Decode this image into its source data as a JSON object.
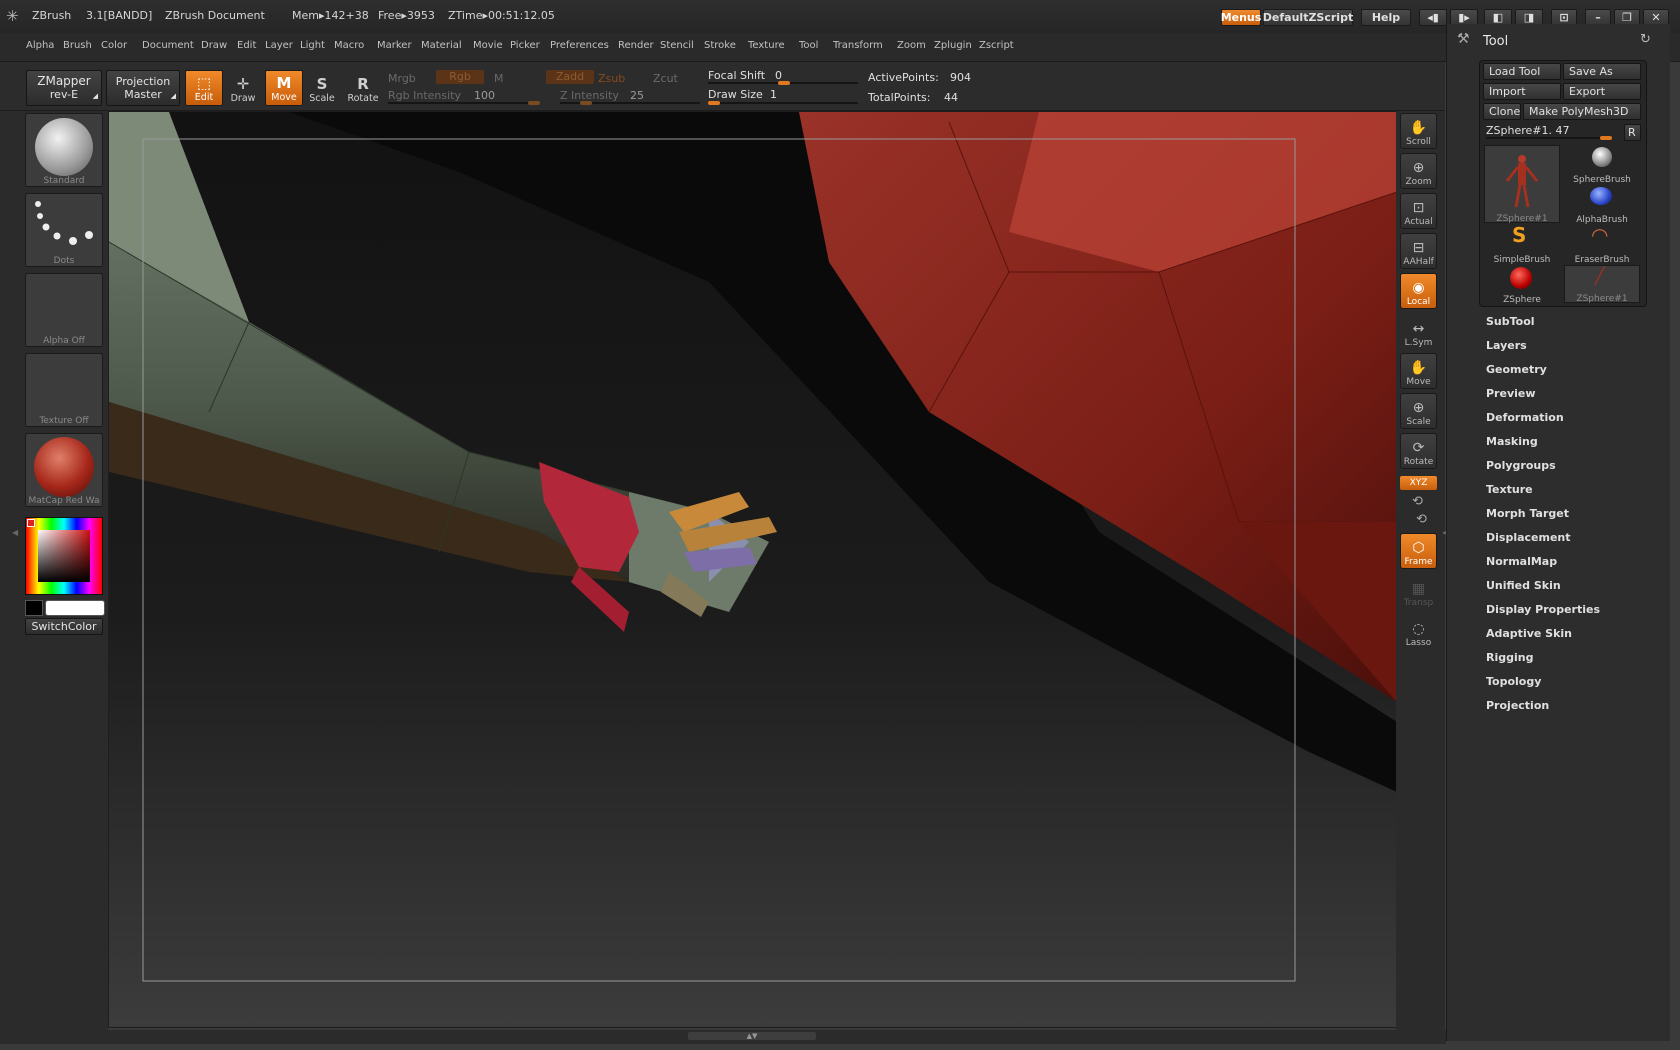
{
  "titlebar": {
    "app_name": "ZBrush",
    "version": "3.1[BANDD]",
    "document": "ZBrush Document",
    "mem": "Mem▸142+38",
    "free": "Free▸3953",
    "ztime": "ZTime▸00:51:12.05",
    "menus_label": "Menus",
    "zscript_label": "DefaultZScript",
    "help_label": "Help"
  },
  "menubar": {
    "items": [
      "Alpha",
      "Brush",
      "Color",
      "Document",
      "Draw",
      "Edit",
      "Layer",
      "Light",
      "Macro",
      "Marker",
      "Material",
      "Movie",
      "Picker",
      "Preferences",
      "Render",
      "Stencil",
      "Stroke",
      "Texture",
      "Tool",
      "Transform",
      "Zoom",
      "Zplugin",
      "Zscript"
    ]
  },
  "shelf": {
    "zmapper_line1": "ZMapper",
    "zmapper_line2": "rev-E",
    "projection_line1": "Projection",
    "projection_line2": "Master",
    "tools": [
      {
        "label": "Edit",
        "active": true
      },
      {
        "label": "Draw",
        "active": false
      },
      {
        "label": "Move",
        "active": true
      },
      {
        "label": "Scale",
        "active": false
      },
      {
        "label": "Rotate",
        "active": false
      }
    ],
    "mrgb": "Mrgb",
    "rgb_btn": "Rgb",
    "m": "M",
    "zadd": "Zadd",
    "zsub": "Zsub",
    "zcut": "Zcut",
    "rgb_intensity_label": "Rgb Intensity",
    "rgb_intensity_value": "100",
    "z_intensity_label": "Z Intensity",
    "z_intensity_value": "25",
    "focal_shift_label": "Focal Shift",
    "focal_shift_value": "0",
    "draw_size_label": "Draw Size",
    "draw_size_value": "1",
    "active_points_label": "ActivePoints:",
    "active_points_value": "904",
    "total_points_label": "TotalPoints:",
    "total_points_value": "44"
  },
  "left_shelf": {
    "brush_label": "Standard",
    "stroke_label": "Dots",
    "alpha_label": "Alpha Off",
    "texture_label": "Texture Off",
    "material_label": "MatCap Red Wa",
    "switch_color": "SwitchColor"
  },
  "right_shelf": {
    "buttons": [
      {
        "label": "Scroll",
        "active": false
      },
      {
        "label": "Zoom",
        "active": false
      },
      {
        "label": "Actual",
        "active": false
      },
      {
        "label": "AAHalf",
        "active": false
      },
      {
        "label": "Local",
        "active": true
      },
      {
        "label": "L.Sym",
        "active": false
      },
      {
        "label": "Move",
        "active": false
      },
      {
        "label": "Scale",
        "active": false
      },
      {
        "label": "Rotate",
        "active": false
      }
    ],
    "xyz_label": "XYZ",
    "frame_label": "Frame",
    "transp_label": "Transp",
    "lasso_label": "Lasso"
  },
  "tool_panel": {
    "title": "Tool",
    "load_tool": "Load Tool",
    "save_as": "Save As",
    "import": "Import",
    "export": "Export",
    "clone": "Clone",
    "make_polymesh": "Make PolyMesh3D",
    "current_tool": "ZSphere#1. 47",
    "r_button": "R",
    "thumbnails": [
      "ZSphere#1",
      "SphereBrush",
      "AlphaBrush",
      "SimpleBrush",
      "EraserBrush",
      "ZSphere",
      "ZSphere#1"
    ],
    "sections": [
      "SubTool",
      "Layers",
      "Geometry",
      "Preview",
      "Deformation",
      "Masking",
      "Polygroups",
      "Texture",
      "Morph Target",
      "Displacement",
      "NormalMap",
      "Unified Skin",
      "Display Properties",
      "Adaptive Skin",
      "Rigging",
      "Topology",
      "Projection"
    ]
  }
}
